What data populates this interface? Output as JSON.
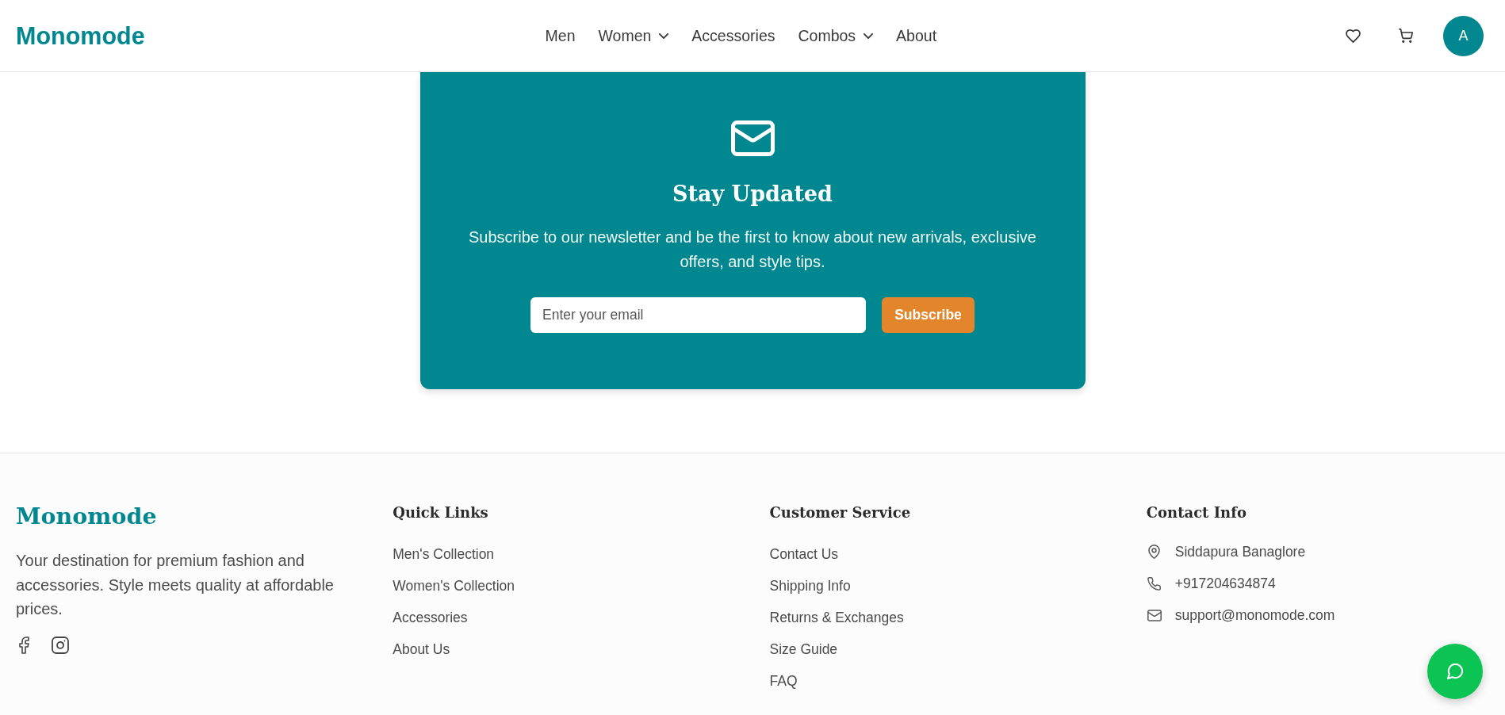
{
  "header": {
    "logo": "Monomode",
    "nav": [
      {
        "label": "Men",
        "has_menu": false
      },
      {
        "label": "Women",
        "has_menu": true
      },
      {
        "label": "Accessories",
        "has_menu": false
      },
      {
        "label": "Combos",
        "has_menu": true
      },
      {
        "label": "About",
        "has_menu": false
      }
    ],
    "avatar": "A"
  },
  "newsletter": {
    "title": "Stay Updated",
    "text": "Subscribe to our newsletter and be the first to know about new arrivals, exclusive offers, and style tips.",
    "email": {
      "placeholder": "Enter your email"
    },
    "button": "Subscribe"
  },
  "footer": {
    "brand": {
      "logo": "Monomode",
      "description": "Your destination for premium fashion and accessories. Style meets quality at affordable prices."
    },
    "columns": [
      {
        "heading": "Quick Links",
        "links": [
          "Men's Collection",
          "Women's Collection",
          "Accessories",
          "About Us"
        ]
      },
      {
        "heading": "Customer Service",
        "links": [
          "Contact Us",
          "Shipping Info",
          "Returns & Exchanges",
          "Size Guide",
          "FAQ"
        ]
      }
    ],
    "contact": {
      "heading": "Contact Info",
      "items": [
        {
          "kind": "address",
          "text": "Siddapura Banaglore"
        },
        {
          "kind": "phone",
          "text": "+917204634874"
        },
        {
          "kind": "email",
          "text": "support@monomode.com"
        }
      ]
    }
  }
}
